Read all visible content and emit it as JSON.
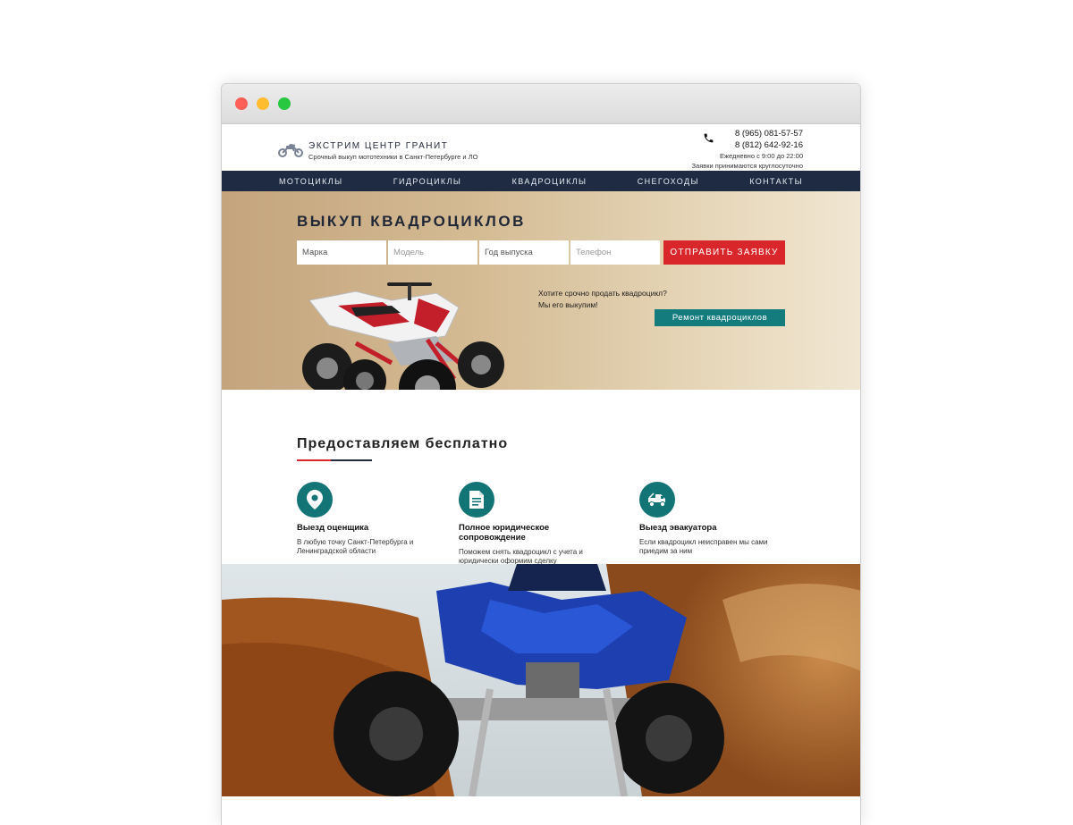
{
  "brand": {
    "name": "ЭКСТРИМ ЦЕНТР ГРАНИТ",
    "tagline": "Срочный выкуп мототехники в Санкт-Петербурге и ЛО"
  },
  "contacts": {
    "phone1": "8 (965) 081-57-57",
    "phone2": "8 (812) 642-92-16",
    "hours": "Ежедневно с 9:00 до 22:00",
    "note": "Заявки принимаются круглосуточно"
  },
  "nav": {
    "items": [
      "МОТОЦИКЛЫ",
      "ГИДРОЦИКЛЫ",
      "КВАДРОЦИКЛЫ",
      "СНЕГОХОДЫ",
      "КОНТАКТЫ"
    ]
  },
  "hero": {
    "title": "ВЫКУП КВАДРОЦИКЛОВ",
    "form": {
      "brand_placeholder": "Марка",
      "model_placeholder": "Модель",
      "year_placeholder": "Год выпуска",
      "phone_placeholder": "Телефон",
      "submit_label": "ОТПРАВИТЬ ЗАЯВКУ"
    },
    "offer_line1": "Хотите срочно продать квадроцикл?",
    "offer_line2": "Мы его выкупим!",
    "repair_label": "Ремонт квадроциклов"
  },
  "free": {
    "title_light": "Предоставляем",
    "title_bold": "бесплатно",
    "features": [
      {
        "icon": "map-pin-icon",
        "title": "Выезд оценщика",
        "desc": "В любую точку Санкт-Петербурга и Ленинградской области"
      },
      {
        "icon": "document-icon",
        "title": "Полное юридическое сопровождение",
        "desc": "Поможем снять квадроцикл с учета и юридически оформим сделку"
      },
      {
        "icon": "tow-truck-icon",
        "title": "Выезд эвакуатора",
        "desc": "Если квадроцикл неисправен мы сами приедим за ним"
      }
    ]
  },
  "colors": {
    "nav_bg": "#1e2b42",
    "accent_red": "#d9262a",
    "accent_teal": "#157c7e"
  }
}
